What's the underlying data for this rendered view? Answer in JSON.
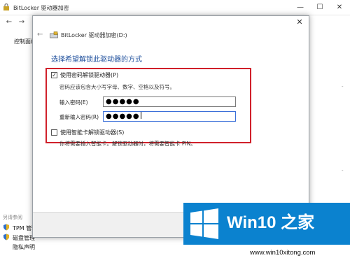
{
  "window": {
    "title": "BitLocker 驱动器加密",
    "minimize_glyph": "—",
    "maximize_glyph": "☐",
    "close_glyph": "✕"
  },
  "nav": {
    "back_glyph": "←",
    "forward_glyph": "→"
  },
  "sidebar": {
    "home_label": "控制面板",
    "see_also_title": "另请参阅",
    "see_also_items": [
      {
        "label": "TPM 管理",
        "icon": "shield-icon"
      },
      {
        "label": "磁盘管理",
        "icon": "shield-icon"
      },
      {
        "label": "隐私声明",
        "icon": ""
      }
    ]
  },
  "right_edge": {
    "line1": "-",
    "line2": "-"
  },
  "dialog": {
    "title": "BitLocker 驱动器加密(D:)",
    "close_glyph": "✕",
    "back_glyph": "←",
    "heading": "选择希望解锁此驱动器的方式",
    "password_option": {
      "label": "使用密码解锁驱动器(P)",
      "checked": true,
      "check_glyph": "✓",
      "hint": "密码应该包含大小写字母、数字、空格以及符号。",
      "enter_label": "输入密码(E)",
      "enter_value": "●●●●●",
      "reenter_label": "重新输入密码(R)",
      "reenter_value": "●●●●●"
    },
    "smartcard_option": {
      "label": "使用智能卡解锁驱动器(S)",
      "checked": false,
      "hint": "你将需要插入智能卡。解锁驱动器时，将需要智能卡 PIN。"
    }
  },
  "watermark": {
    "brand": "Win10 之家",
    "url": "www.win10xitong.com",
    "color": "#0b82cf"
  },
  "colors": {
    "highlight": "#d0202a",
    "heading": "#1e4f9c"
  }
}
